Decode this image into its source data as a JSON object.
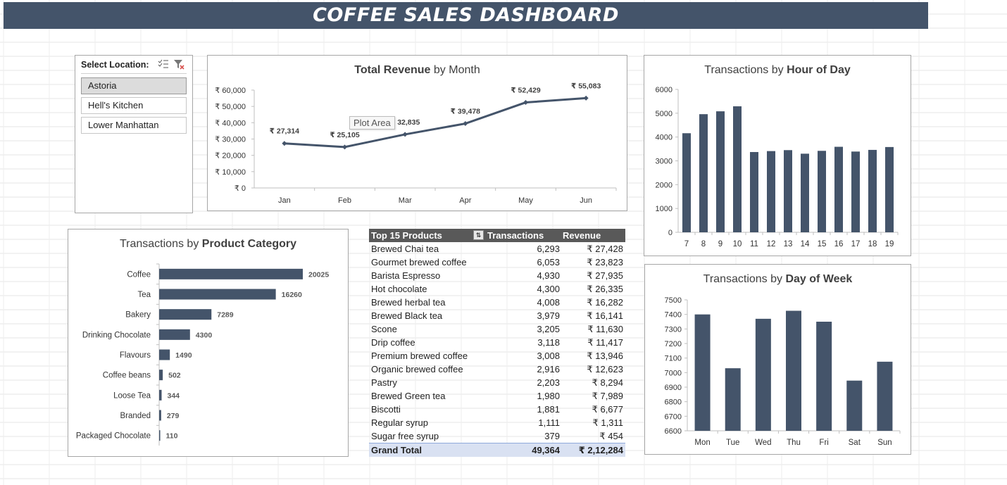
{
  "dashboard_title": "COFFEE SALES DASHBOARD",
  "colors": {
    "bar": "#44546a",
    "header_bg": "#44546a",
    "total_row_bg": "#d9e1f2"
  },
  "slicer": {
    "header": "Select Location:",
    "icons": [
      "multi-select-icon",
      "clear-filter-icon"
    ],
    "items": [
      {
        "label": "Astoria",
        "selected": true
      },
      {
        "label": "Hell's Kitchen",
        "selected": false
      },
      {
        "label": "Lower Manhattan",
        "selected": false
      }
    ]
  },
  "tooltip_text": "Plot Area",
  "revenue_chart": {
    "title_bold": "Total Revenue",
    "title_rest": " by Month",
    "chart_data": {
      "type": "line",
      "categories": [
        "Jan",
        "Feb",
        "Mar",
        "Apr",
        "May",
        "Jun"
      ],
      "values": [
        27314,
        25105,
        32835,
        39478,
        52429,
        55083
      ],
      "data_labels": [
        "₹ 27,314",
        "₹ 25,105",
        "₹ 32,835",
        "₹ 39,478",
        "₹ 52,429",
        "₹ 55,083"
      ],
      "ylim": [
        0,
        60000
      ],
      "yticks": [
        "₹ 0",
        "₹ 10,000",
        "₹ 20,000",
        "₹ 30,000",
        "₹ 40,000",
        "₹ 50,000",
        "₹ 60,000"
      ]
    }
  },
  "hour_chart": {
    "title_rest": "Transactions by ",
    "title_bold": "Hour of Day",
    "chart_data": {
      "type": "bar",
      "categories": [
        "7",
        "8",
        "9",
        "10",
        "11",
        "12",
        "13",
        "14",
        "15",
        "16",
        "17",
        "18",
        "19"
      ],
      "values": [
        4160,
        4960,
        5080,
        5290,
        3370,
        3410,
        3450,
        3300,
        3420,
        3590,
        3390,
        3460,
        3580
      ],
      "ylim": [
        0,
        6000
      ],
      "yticks": [
        "0",
        "1000",
        "2000",
        "3000",
        "4000",
        "5000",
        "6000"
      ]
    }
  },
  "category_chart": {
    "title_rest": "Transactions by ",
    "title_bold": "Product Category",
    "chart_data": {
      "type": "bar",
      "orientation": "horizontal",
      "categories": [
        "Coffee",
        "Tea",
        "Bakery",
        "Drinking Chocolate",
        "Flavours",
        "Coffee beans",
        "Loose Tea",
        "Branded",
        "Packaged Chocolate"
      ],
      "values": [
        20025,
        16260,
        7289,
        4300,
        1490,
        502,
        344,
        279,
        110
      ],
      "data_labels": [
        "20025",
        "16260",
        "7289",
        "4300",
        "1490",
        "502",
        "344",
        "279",
        "110"
      ]
    }
  },
  "day_chart": {
    "title_rest": "Transactions by ",
    "title_bold": "Day of Week",
    "chart_data": {
      "type": "bar",
      "categories": [
        "Mon",
        "Tue",
        "Wed",
        "Thu",
        "Fri",
        "Sat",
        "Sun"
      ],
      "values": [
        7400,
        7030,
        7370,
        7425,
        7350,
        6945,
        7075
      ],
      "ylim": [
        6600,
        7500
      ],
      "yticks": [
        "6600",
        "6700",
        "6800",
        "6900",
        "7000",
        "7100",
        "7200",
        "7300",
        "7400",
        "7500"
      ]
    }
  },
  "products_table": {
    "headers": [
      "Top 15 Products",
      "Transactions",
      "Revenue"
    ],
    "rows": [
      [
        "Brewed Chai tea",
        "6,293",
        "₹ 27,428"
      ],
      [
        "Gourmet brewed coffee",
        "6,053",
        "₹ 23,823"
      ],
      [
        "Barista Espresso",
        "4,930",
        "₹ 27,935"
      ],
      [
        "Hot chocolate",
        "4,300",
        "₹ 26,335"
      ],
      [
        "Brewed herbal tea",
        "4,008",
        "₹ 16,282"
      ],
      [
        "Brewed Black tea",
        "3,979",
        "₹ 16,141"
      ],
      [
        "Scone",
        "3,205",
        "₹ 11,630"
      ],
      [
        "Drip coffee",
        "3,118",
        "₹ 11,417"
      ],
      [
        "Premium brewed coffee",
        "3,008",
        "₹ 13,946"
      ],
      [
        "Organic brewed coffee",
        "2,916",
        "₹ 12,623"
      ],
      [
        "Pastry",
        "2,203",
        "₹ 8,294"
      ],
      [
        "Brewed Green tea",
        "1,980",
        "₹ 7,989"
      ],
      [
        "Biscotti",
        "1,881",
        "₹ 6,677"
      ],
      [
        "Regular syrup",
        "1,111",
        "₹ 1,311"
      ],
      [
        "Sugar free syrup",
        "379",
        "₹ 454"
      ]
    ],
    "total": [
      "Grand Total",
      "49,364",
      "₹ 2,12,284"
    ]
  }
}
